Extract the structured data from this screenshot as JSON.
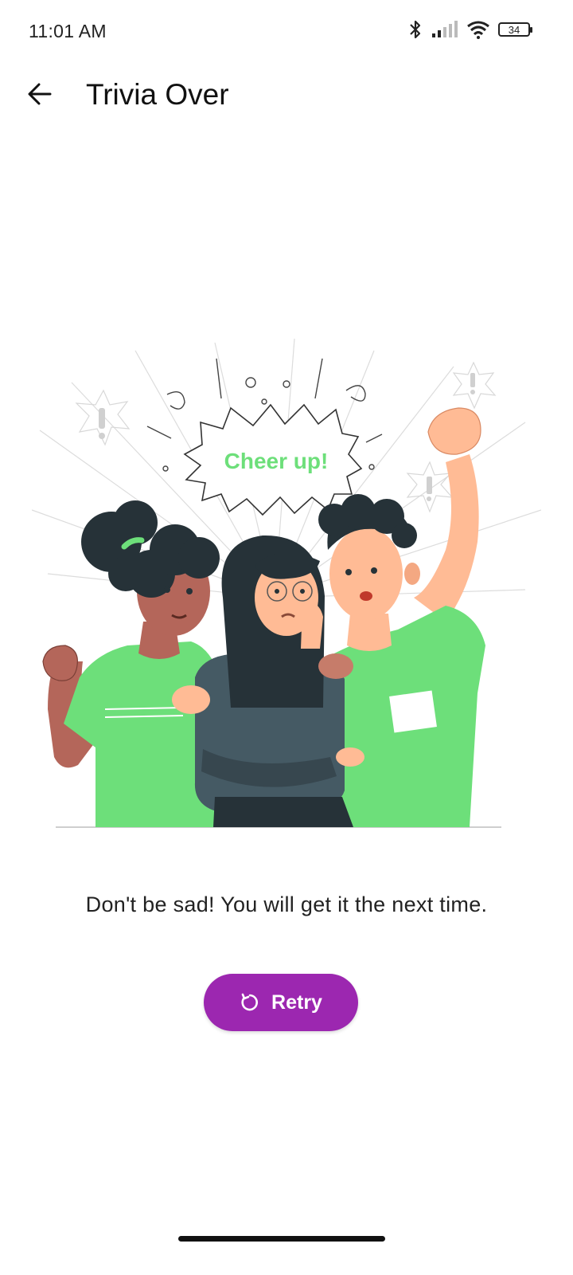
{
  "status": {
    "time": "11:01 AM",
    "battery": "34",
    "icons": [
      "bluetooth-icon",
      "signal-icon",
      "wifi-icon",
      "battery-icon"
    ]
  },
  "appbar": {
    "title": "Trivia Over",
    "back_icon": "arrow-left-icon"
  },
  "illustration": {
    "speech": "Cheer up!"
  },
  "content": {
    "message": "Don't be sad! You will get it the next time."
  },
  "actions": {
    "retry_label": "Retry",
    "retry_icon": "refresh-icon"
  },
  "colors": {
    "accent": "#9c27b0",
    "shirt_green": "#6ddf7a",
    "speech_text": "#6ddf7a"
  }
}
